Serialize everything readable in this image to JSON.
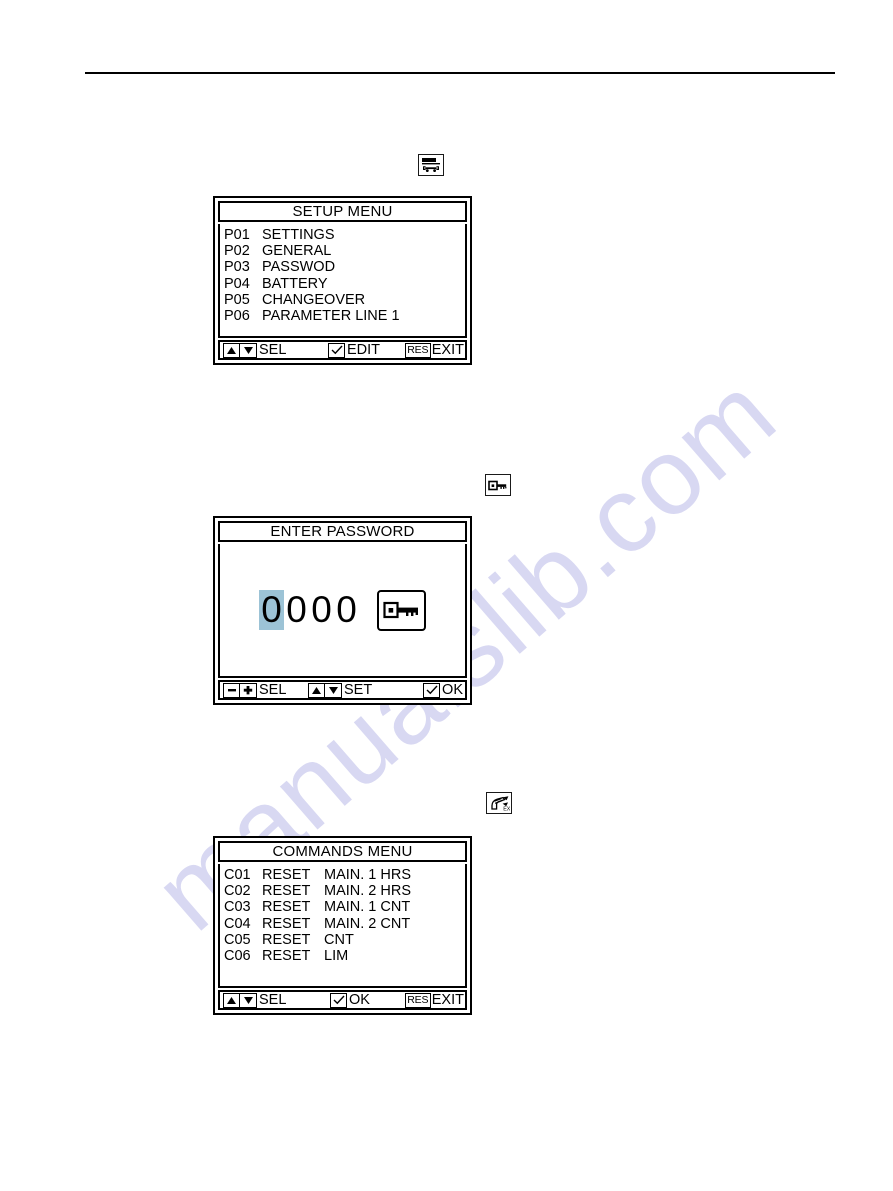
{
  "page": {
    "background": "#ffffff",
    "rule_color": "#000000",
    "highlight_color": "#9cc3d6",
    "watermark_text": "manualslib.com",
    "watermark_color": "#d8d8f2"
  },
  "screens": [
    {
      "id": "setup-menu",
      "icon_name": "wrench-settings-icon",
      "title": "SETUP MENU",
      "rows": [
        {
          "code": "P01",
          "label": "SETTINGS"
        },
        {
          "code": "P02",
          "label": "GENERAL"
        },
        {
          "code": "P03",
          "label": "PASSWOD"
        },
        {
          "code": "P04",
          "label": "BATTERY"
        },
        {
          "code": "P05",
          "label": "CHANGEOVER"
        },
        {
          "code": "P06",
          "label": "PARAMETER LINE 1"
        }
      ],
      "footer": {
        "sel_label": "SEL",
        "action_label": "EDIT",
        "res_label": "RES",
        "exit_label": "EXIT"
      }
    },
    {
      "id": "enter-password",
      "icon_name": "key-icon",
      "title": "ENTER PASSWORD",
      "password": {
        "digits": [
          "0",
          "0",
          "0",
          "0"
        ],
        "selected_index": 0,
        "key_button_name": "key-icon"
      },
      "footer": {
        "sel_label": "SEL",
        "set_label": "SET",
        "ok_label": "OK"
      }
    },
    {
      "id": "commands-menu",
      "icon_name": "hand-command-icon",
      "title": "COMMANDS MENU",
      "rows": [
        {
          "code": "C01",
          "action": "RESET",
          "label": "MAIN. 1 HRS"
        },
        {
          "code": "C02",
          "action": "RESET",
          "label": "MAIN. 2 HRS"
        },
        {
          "code": "C03",
          "action": "RESET",
          "label": "MAIN. 1 CNT"
        },
        {
          "code": "C04",
          "action": "RESET",
          "label": "MAIN. 2 CNT"
        },
        {
          "code": "C05",
          "action": "RESET",
          "label": "CNT"
        },
        {
          "code": "C06",
          "action": "RESET",
          "label": "LIM"
        }
      ],
      "footer": {
        "sel_label": "SEL",
        "action_label": "OK",
        "res_label": "RES",
        "exit_label": "EXIT"
      }
    }
  ]
}
